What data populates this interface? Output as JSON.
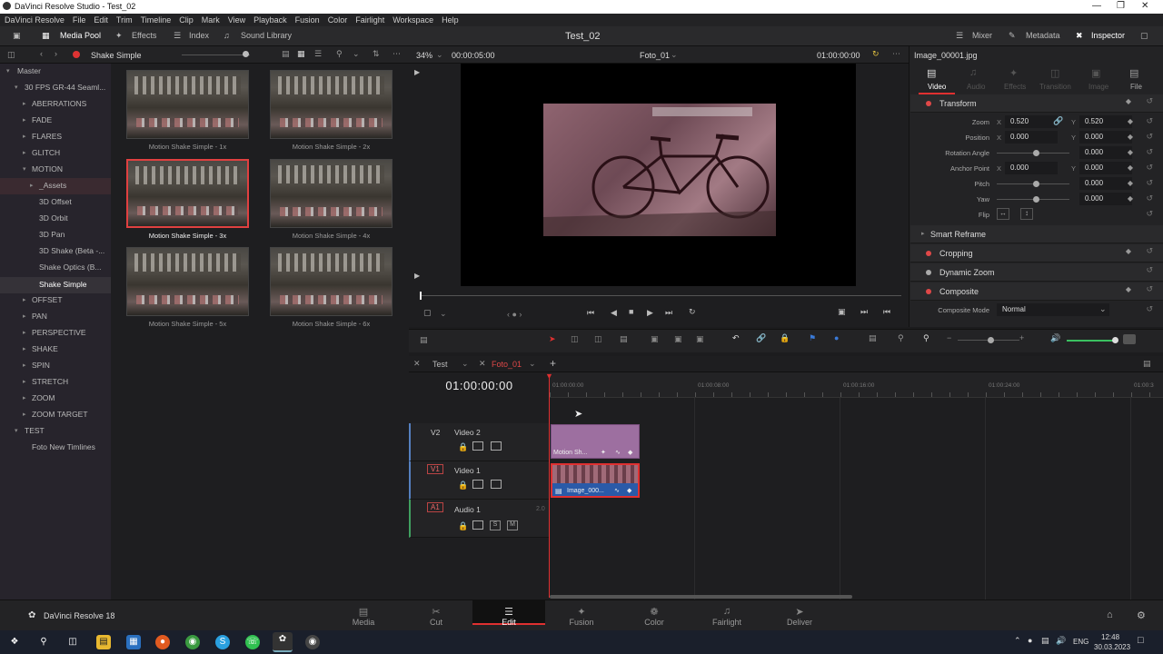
{
  "window": {
    "title": "DaVinci Resolve Studio - Test_02"
  },
  "menu": [
    "DaVinci Resolve",
    "File",
    "Edit",
    "Trim",
    "Timeline",
    "Clip",
    "Mark",
    "View",
    "Playback",
    "Fusion",
    "Color",
    "Fairlight",
    "Workspace",
    "Help"
  ],
  "toolbar": {
    "media_pool": "Media Pool",
    "effects": "Effects",
    "index": "Index",
    "sound_library": "Sound Library",
    "project": "Test_02",
    "mixer": "Mixer",
    "metadata": "Metadata",
    "inspector": "Inspector"
  },
  "pool_header": {
    "title": "Shake Simple"
  },
  "bin": {
    "master": "Master",
    "items": [
      "30 FPS GR-44 Seaml...",
      "ABERRATIONS",
      "FADE",
      "FLARES",
      "GLITCH",
      "MOTION",
      "_Assets",
      "3D Offset",
      "3D Orbit",
      "3D Pan",
      "3D Shake (Beta -...",
      "Shake Optics (B...",
      "Shake Simple",
      "OFFSET",
      "PAN",
      "PERSPECTIVE",
      "SHAKE",
      "SPIN",
      "STRETCH",
      "ZOOM",
      "ZOOM TARGET",
      "TEST",
      "Foto New Timlines"
    ]
  },
  "thumbs": [
    "Motion Shake Simple - 1x",
    "Motion Shake Simple - 2x",
    "Motion Shake Simple - 3x",
    "Motion Shake Simple - 4x",
    "Motion Shake Simple - 5x",
    "Motion Shake Simple - 6x"
  ],
  "viewer": {
    "zoom": "34%",
    "duration": "00:00:05:00",
    "clip": "Foto_01",
    "timecode": "01:00:00:00"
  },
  "inspector": {
    "file": "Image_00001.jpg",
    "tabs": [
      "Video",
      "Audio",
      "Effects",
      "Transition",
      "Image",
      "File"
    ],
    "transform": "Transform",
    "zoom_label": "Zoom",
    "zoom_x": "0.520",
    "zoom_y": "0.520",
    "position_label": "Position",
    "pos_x": "0.000",
    "pos_y": "0.000",
    "rotation_label": "Rotation Angle",
    "rotation": "0.000",
    "anchor_label": "Anchor Point",
    "anchor_x": "0.000",
    "anchor_y": "0.000",
    "pitch_label": "Pitch",
    "pitch": "0.000",
    "yaw_label": "Yaw",
    "yaw": "0.000",
    "flip_label": "Flip",
    "smart_reframe": "Smart Reframe",
    "cropping": "Cropping",
    "dynamic_zoom": "Dynamic Zoom",
    "composite": "Composite",
    "composite_mode_label": "Composite Mode",
    "composite_mode": "Normal",
    "x": "X",
    "y": "Y"
  },
  "timeline": {
    "tab1": "Test",
    "tab2": "Foto_01",
    "timecode": "01:00:00:00",
    "ruler": [
      "01:00:00:00",
      "01:00:08:00",
      "01:00:16:00",
      "01:00:24:00",
      "01:00:3"
    ],
    "tracks": [
      {
        "badge": "V2",
        "name": "Video 2"
      },
      {
        "badge": "V1",
        "name": "Video 1"
      },
      {
        "badge": "A1",
        "name": "Audio 1",
        "ch": "2.0"
      }
    ],
    "clip_v2": "Motion Sh...",
    "clip_v1": "Image_000..."
  },
  "pages": {
    "brand": "DaVinci Resolve 18",
    "items": [
      "Media",
      "Cut",
      "Edit",
      "Fusion",
      "Color",
      "Fairlight",
      "Deliver"
    ]
  },
  "taskbar": {
    "lang": "ENG",
    "time": "12:48",
    "date": "30.03.2023"
  }
}
